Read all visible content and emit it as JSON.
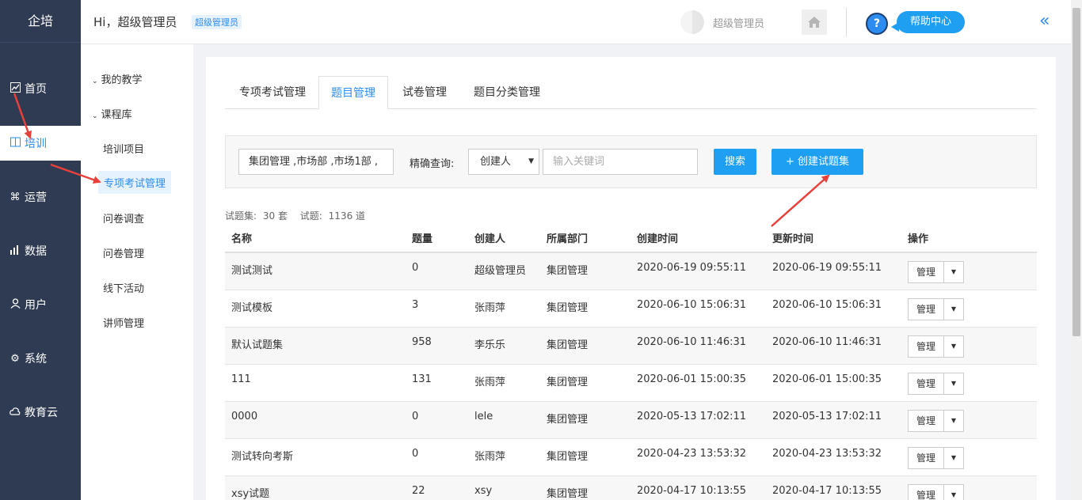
{
  "nav": {
    "brand": "企培",
    "items": [
      {
        "label": "首页",
        "icon": "chart-icon"
      },
      {
        "label": "培训",
        "icon": "book-icon",
        "active": true
      },
      {
        "label": "运营",
        "icon": "command-icon"
      },
      {
        "label": "数据",
        "icon": "bar-chart-icon"
      },
      {
        "label": "用户",
        "icon": "user-icon"
      },
      {
        "label": "系统",
        "icon": "gear-icon"
      },
      {
        "label": "教育云",
        "icon": "cloud-icon"
      }
    ]
  },
  "header": {
    "greeting": "Hi，超级管理员",
    "role_badge": "超级管理员",
    "user_name": "超级管理员",
    "help_label": "帮助中心",
    "help_q": "?",
    "collapse_glyph": "«"
  },
  "submenu": {
    "items": [
      {
        "label": "我的教学",
        "type": "group"
      },
      {
        "label": "课程库",
        "type": "group"
      },
      {
        "label": "培训项目",
        "type": "leaf"
      },
      {
        "label": "专项考试管理",
        "type": "leaf",
        "active": true
      },
      {
        "label": "问卷调查",
        "type": "leaf"
      },
      {
        "label": "问卷管理",
        "type": "leaf"
      },
      {
        "label": "线下活动",
        "type": "leaf"
      },
      {
        "label": "讲师管理",
        "type": "leaf"
      }
    ]
  },
  "tabs": [
    {
      "label": "专项考试管理"
    },
    {
      "label": "题目管理",
      "active": true
    },
    {
      "label": "试卷管理"
    },
    {
      "label": "题目分类管理"
    }
  ],
  "filter": {
    "dept_value": "集团管理 ,市场部 ,市场1部 ,",
    "query_label": "精确查询:",
    "select_value": "创建人",
    "keyword_placeholder": "输入关键词",
    "search_label": "搜索",
    "create_label": "+ 创建试题集"
  },
  "summary": {
    "set_label": "试题集:",
    "set_count": "30 套",
    "q_label": "试题:",
    "q_count": "1136 道"
  },
  "table": {
    "headers": [
      "名称",
      "题量",
      "创建人",
      "所属部门",
      "创建时间",
      "更新时间",
      "操作"
    ],
    "manage_label": "管理",
    "rows": [
      {
        "name": "测试测试",
        "count": "0",
        "creator": "超级管理员",
        "dept": "集团管理",
        "created": "2020-06-19 09:55:11",
        "updated": "2020-06-19 09:55:11"
      },
      {
        "name": "测试模板",
        "count": "3",
        "creator": "张雨萍",
        "dept": "集团管理",
        "created": "2020-06-10 15:06:31",
        "updated": "2020-06-10 15:06:31"
      },
      {
        "name": "默认试题集",
        "count": "958",
        "creator": "李乐乐",
        "dept": "集团管理",
        "created": "2020-06-10 11:46:31",
        "updated": "2020-06-10 11:46:31"
      },
      {
        "name": "111",
        "count": "131",
        "creator": "张雨萍",
        "dept": "集团管理",
        "created": "2020-06-01 15:00:35",
        "updated": "2020-06-01 15:00:35"
      },
      {
        "name": "0000",
        "count": "0",
        "creator": "lele",
        "dept": "集团管理",
        "created": "2020-05-13 17:02:11",
        "updated": "2020-05-13 17:02:11"
      },
      {
        "name": "测试转向考斯",
        "count": "0",
        "creator": "张雨萍",
        "dept": "集团管理",
        "created": "2020-04-23 13:53:32",
        "updated": "2020-04-23 13:53:32"
      },
      {
        "name": "xsy试题",
        "count": "22",
        "creator": "xsy",
        "dept": "集团管理",
        "created": "2020-04-17 10:13:55",
        "updated": "2020-04-17 10:13:55"
      }
    ]
  },
  "colors": {
    "nav_bg": "#2f3b52",
    "accent": "#1e9ff2",
    "annotation": "#e8403a"
  }
}
